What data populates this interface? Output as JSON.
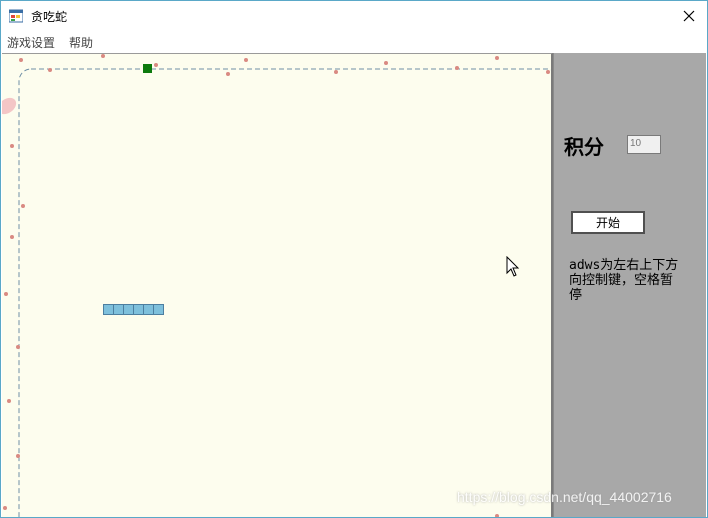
{
  "window": {
    "title": "贪吃蛇",
    "icon": "app-window-icon",
    "close_icon": "close-icon"
  },
  "menu": {
    "items": [
      {
        "label": "游戏设置"
      },
      {
        "label": "帮助"
      }
    ]
  },
  "game": {
    "snake_length": 6,
    "food_color": "#0d7a0d",
    "snake_color": "#7ec0dc",
    "background_color": "#fdfdee"
  },
  "panel": {
    "score_label": "积分",
    "score_value": "10",
    "start_button": "开始",
    "help_text": "adws为左右上下方向控制键，空格暂停"
  },
  "watermark": "https://blog.csdn.net/qq_44002716"
}
